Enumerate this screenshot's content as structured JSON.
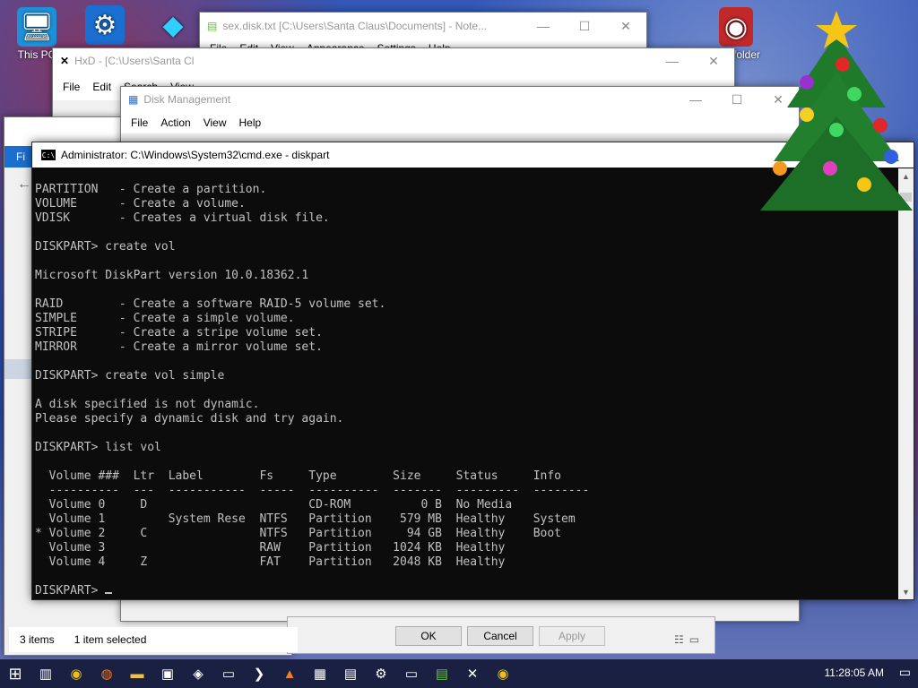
{
  "desktop": {
    "icons": [
      {
        "label": "This PC"
      },
      {
        "label": ""
      },
      {
        "label": ""
      },
      {
        "label": "folder"
      }
    ]
  },
  "notepad": {
    "title": "sex.disk.txt [C:\\Users\\Santa Claus\\Documents] - Note...",
    "menu": [
      "File",
      "Edit",
      "View",
      "Appearance",
      "Settings",
      "Help"
    ]
  },
  "hxd": {
    "title": "HxD - [C:\\Users\\Santa Cl",
    "menu": [
      "File",
      "Edit",
      "Search",
      "View"
    ]
  },
  "diskmgmt": {
    "title": "Disk Management",
    "menu": [
      "File",
      "Action",
      "View",
      "Help"
    ]
  },
  "explorer": {
    "tab_fi": "Fi",
    "status_items": "3 items",
    "status_selected": "1 item selected"
  },
  "cmd": {
    "title": "Administrator: C:\\Windows\\System32\\cmd.exe - diskpart",
    "lines": [
      "PARTITION   - Create a partition.",
      "VOLUME      - Create a volume.",
      "VDISK       - Creates a virtual disk file.",
      "",
      "DISKPART> create vol",
      "",
      "Microsoft DiskPart version 10.0.18362.1",
      "",
      "RAID        - Create a software RAID-5 volume set.",
      "SIMPLE      - Create a simple volume.",
      "STRIPE      - Create a stripe volume set.",
      "MIRROR      - Create a mirror volume set.",
      "",
      "DISKPART> create vol simple",
      "",
      "A disk specified is not dynamic.",
      "Please specify a dynamic disk and try again.",
      "",
      "DISKPART> list vol",
      "",
      "  Volume ###  Ltr  Label        Fs     Type        Size     Status     Info",
      "  ----------  ---  -----------  -----  ----------  -------  ---------  --------",
      "  Volume 0     D                       CD-ROM          0 B  No Media",
      "  Volume 1         System Rese  NTFS   Partition    579 MB  Healthy    System",
      "* Volume 2     C                NTFS   Partition     94 GB  Healthy    Boot",
      "  Volume 3                      RAW    Partition   1024 KB  Healthy",
      "  Volume 4     Z                FAT    Partition   2048 KB  Healthy",
      ""
    ],
    "prompt": "DISKPART> "
  },
  "dialog": {
    "ok": "OK",
    "cancel": "Cancel",
    "apply": "Apply"
  },
  "taskbar": {
    "clock": "11:28:05 AM"
  }
}
